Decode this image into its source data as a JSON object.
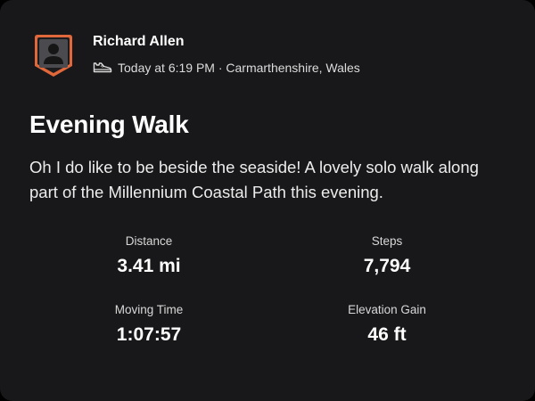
{
  "athlete": {
    "name": "Richard Allen",
    "avatar_icon": "user-silhouette-icon",
    "avatar_colors": {
      "fill": "#4b4b4f",
      "border": "#e0683a"
    }
  },
  "activity_meta": {
    "sport_icon": "shoe-icon",
    "text": "Today at 6:19 PM · Carmarthenshire, Wales"
  },
  "activity": {
    "title": "Evening Walk",
    "description": "Oh I do like to be beside the seaside! A lovely solo walk along part of the Millennium Coastal Path this evening."
  },
  "stats": [
    {
      "label": "Distance",
      "value": "3.41 mi"
    },
    {
      "label": "Steps",
      "value": "7,794"
    },
    {
      "label": "Moving Time",
      "value": "1:07:57"
    },
    {
      "label": "Elevation Gain",
      "value": "46 ft"
    }
  ],
  "colors": {
    "background": "#18181a",
    "text_primary": "#ffffff",
    "accent": "#e0683a"
  }
}
